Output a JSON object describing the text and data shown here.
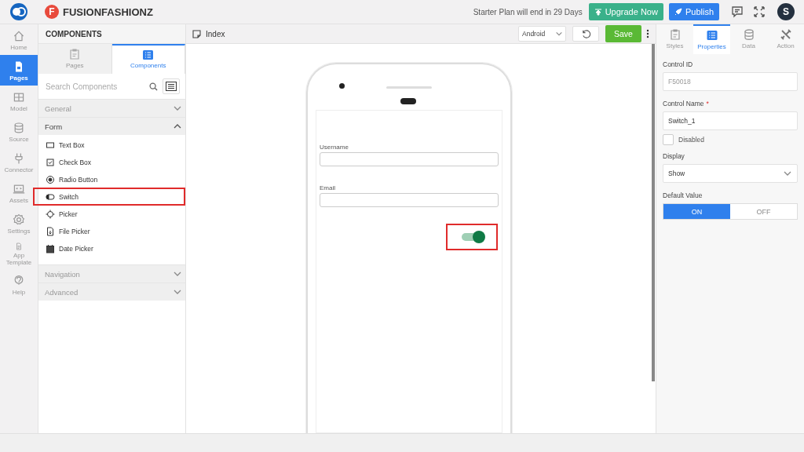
{
  "app": {
    "logo_letter": "F",
    "name": "FUSIONFASHIONZ",
    "plan_notice": "Starter Plan will end in 29 Days",
    "upgrade_button": "Upgrade Now",
    "publish_button": "Publish",
    "avatar_letter": "S"
  },
  "rail": [
    {
      "label": "Home",
      "selected": false
    },
    {
      "label": "Pages",
      "selected": true
    },
    {
      "label": "Model",
      "selected": false
    },
    {
      "label": "Source",
      "selected": false
    },
    {
      "label": "Connector",
      "selected": false
    },
    {
      "label": "Assets",
      "selected": false
    },
    {
      "label": "Settings",
      "selected": false
    },
    {
      "label": "App Template",
      "selected": false
    },
    {
      "label": "Help",
      "selected": false
    }
  ],
  "components_panel": {
    "title": "COMPONENTS",
    "tabs": [
      {
        "label": "Pages",
        "selected": false
      },
      {
        "label": "Components",
        "selected": true
      }
    ],
    "search": {
      "placeholder": "Search Components"
    },
    "sections": [
      {
        "label": "General",
        "expanded": false
      },
      {
        "label": "Form",
        "expanded": true,
        "items": [
          {
            "label": "Text Box",
            "highlighted": false
          },
          {
            "label": "Check Box",
            "highlighted": false
          },
          {
            "label": "Radio Button",
            "highlighted": false
          },
          {
            "label": "Switch",
            "highlighted": true
          },
          {
            "label": "Picker",
            "highlighted": false
          },
          {
            "label": "File Picker",
            "highlighted": false
          },
          {
            "label": "Date Picker",
            "highlighted": false
          }
        ]
      },
      {
        "label": "Navigation",
        "expanded": false
      },
      {
        "label": "Advanced",
        "expanded": false
      }
    ]
  },
  "editor": {
    "page_name": "Index",
    "platform": "Android",
    "save_button": "Save",
    "phone": {
      "fields": [
        {
          "label": "Username"
        },
        {
          "label": "Email"
        }
      ],
      "switch": {
        "on": true,
        "highlighted": true
      }
    }
  },
  "properties_panel": {
    "tabs": [
      {
        "label": "Styles",
        "selected": false
      },
      {
        "label": "Properties",
        "selected": true
      },
      {
        "label": "Data",
        "selected": false
      },
      {
        "label": "Action",
        "selected": false
      }
    ],
    "control_id": {
      "label": "Control ID",
      "value": "F50018"
    },
    "control_name": {
      "label": "Control Name",
      "required_mark": "*",
      "value": "Switch_1"
    },
    "disabled": {
      "label": "Disabled",
      "checked": false
    },
    "display": {
      "label": "Display",
      "value": "Show"
    },
    "default_value": {
      "label": "Default Value",
      "options": [
        {
          "label": "ON",
          "selected": true
        },
        {
          "label": "OFF",
          "selected": false
        }
      ]
    }
  }
}
